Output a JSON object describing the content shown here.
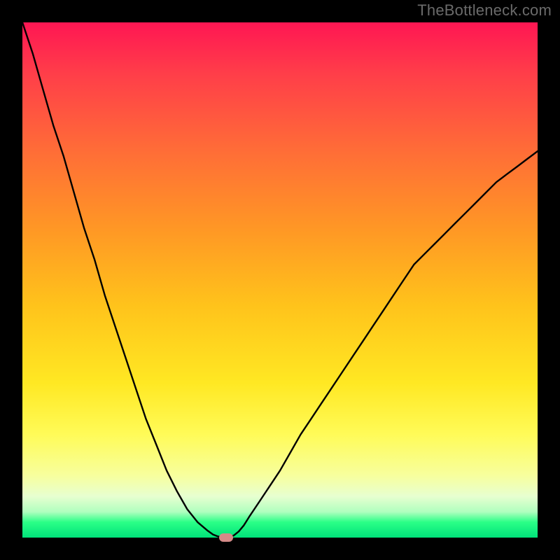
{
  "watermark": "TheBottleneck.com",
  "colors": {
    "frame": "#000000",
    "curve": "#000000",
    "marker": "#d48a88",
    "gradient_stops": [
      "#ff1653",
      "#ff3e49",
      "#ff6d37",
      "#ff9725",
      "#ffc31b",
      "#ffe823",
      "#fffb58",
      "#f7ff9e",
      "#e7ffd0",
      "#b0ffbf",
      "#2bff87",
      "#00e27a"
    ]
  },
  "chart_data": {
    "type": "line",
    "title": "",
    "xlabel": "",
    "ylabel": "",
    "xlim": [
      0,
      100
    ],
    "ylim": [
      0,
      100
    ],
    "x": [
      0,
      2,
      4,
      6,
      8,
      10,
      12,
      14,
      16,
      18,
      20,
      22,
      24,
      26,
      28,
      30,
      32,
      34,
      36,
      37,
      38,
      39,
      40,
      41,
      42,
      43,
      44,
      46,
      48,
      50,
      52,
      54,
      56,
      58,
      60,
      62,
      64,
      66,
      68,
      70,
      72,
      74,
      76,
      78,
      80,
      82,
      84,
      86,
      88,
      90,
      92,
      94,
      96,
      98,
      100
    ],
    "values": [
      100,
      94,
      87,
      80,
      74,
      67,
      60,
      54,
      47,
      41,
      35,
      29,
      23,
      18,
      13,
      9,
      5.5,
      3,
      1.3,
      0.6,
      0.2,
      0.1,
      0.1,
      0.4,
      1.2,
      2.4,
      4,
      7,
      10,
      13,
      16.5,
      20,
      23,
      26,
      29,
      32,
      35,
      38,
      41,
      44,
      47,
      50,
      53,
      55,
      57,
      59,
      61,
      63,
      65,
      67,
      69,
      70.5,
      72,
      73.5,
      75
    ],
    "marker": {
      "x": 39.5,
      "y": 0
    },
    "grid": false,
    "legend": false
  }
}
